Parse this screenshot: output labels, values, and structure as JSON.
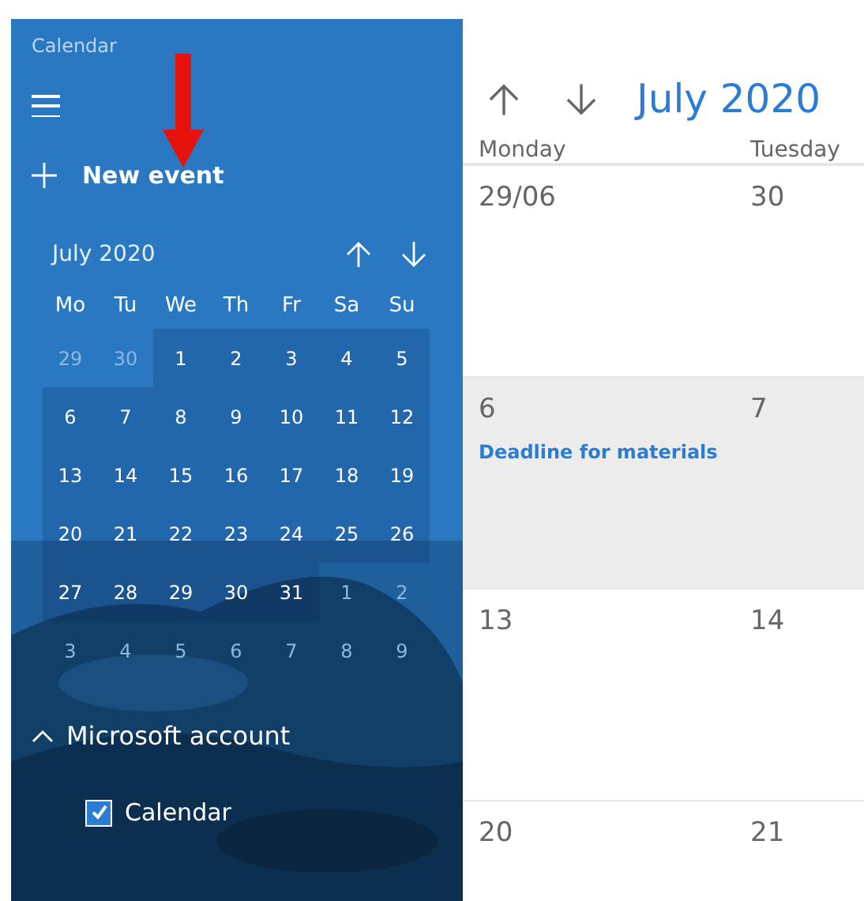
{
  "app_title": "Calendar",
  "new_event": "New event",
  "mini_calendar": {
    "month": "July 2020",
    "weekdays": [
      "Mo",
      "Tu",
      "We",
      "Th",
      "Fr",
      "Sa",
      "Su"
    ],
    "days": [
      {
        "label": "29",
        "in_month": false
      },
      {
        "label": "30",
        "in_month": false
      },
      {
        "label": "1",
        "in_month": true
      },
      {
        "label": "2",
        "in_month": true
      },
      {
        "label": "3",
        "in_month": true
      },
      {
        "label": "4",
        "in_month": true
      },
      {
        "label": "5",
        "in_month": true
      },
      {
        "label": "6",
        "in_month": true
      },
      {
        "label": "7",
        "in_month": true
      },
      {
        "label": "8",
        "in_month": true
      },
      {
        "label": "9",
        "in_month": true
      },
      {
        "label": "10",
        "in_month": true
      },
      {
        "label": "11",
        "in_month": true
      },
      {
        "label": "12",
        "in_month": true
      },
      {
        "label": "13",
        "in_month": true
      },
      {
        "label": "14",
        "in_month": true
      },
      {
        "label": "15",
        "in_month": true
      },
      {
        "label": "16",
        "in_month": true
      },
      {
        "label": "17",
        "in_month": true
      },
      {
        "label": "18",
        "in_month": true
      },
      {
        "label": "19",
        "in_month": true
      },
      {
        "label": "20",
        "in_month": true
      },
      {
        "label": "21",
        "in_month": true
      },
      {
        "label": "22",
        "in_month": true
      },
      {
        "label": "23",
        "in_month": true
      },
      {
        "label": "24",
        "in_month": true
      },
      {
        "label": "25",
        "in_month": true
      },
      {
        "label": "26",
        "in_month": true
      },
      {
        "label": "27",
        "in_month": true
      },
      {
        "label": "28",
        "in_month": true
      },
      {
        "label": "29",
        "in_month": true
      },
      {
        "label": "30",
        "in_month": true
      },
      {
        "label": "31",
        "in_month": true
      },
      {
        "label": "1",
        "in_month": false
      },
      {
        "label": "2",
        "in_month": false
      },
      {
        "label": "3",
        "in_month": false
      },
      {
        "label": "4",
        "in_month": false
      },
      {
        "label": "5",
        "in_month": false
      },
      {
        "label": "6",
        "in_month": false
      },
      {
        "label": "7",
        "in_month": false
      },
      {
        "label": "8",
        "in_month": false
      },
      {
        "label": "9",
        "in_month": false
      }
    ]
  },
  "account": {
    "label": "Microsoft account",
    "expanded": true,
    "calendars": [
      {
        "label": "Calendar",
        "checked": true
      }
    ]
  },
  "main": {
    "month": "July 2020",
    "columns": [
      "Monday",
      "Tuesday"
    ],
    "weeks": [
      {
        "shaded": false,
        "days": [
          {
            "date": "29/06"
          },
          {
            "date": "30"
          }
        ]
      },
      {
        "shaded": true,
        "days": [
          {
            "date": "6",
            "events": [
              "Deadline for materials"
            ]
          },
          {
            "date": "7"
          }
        ]
      },
      {
        "shaded": false,
        "days": [
          {
            "date": "13"
          },
          {
            "date": "14"
          }
        ]
      },
      {
        "shaded": false,
        "days": [
          {
            "date": "20"
          },
          {
            "date": "21"
          }
        ]
      }
    ]
  }
}
